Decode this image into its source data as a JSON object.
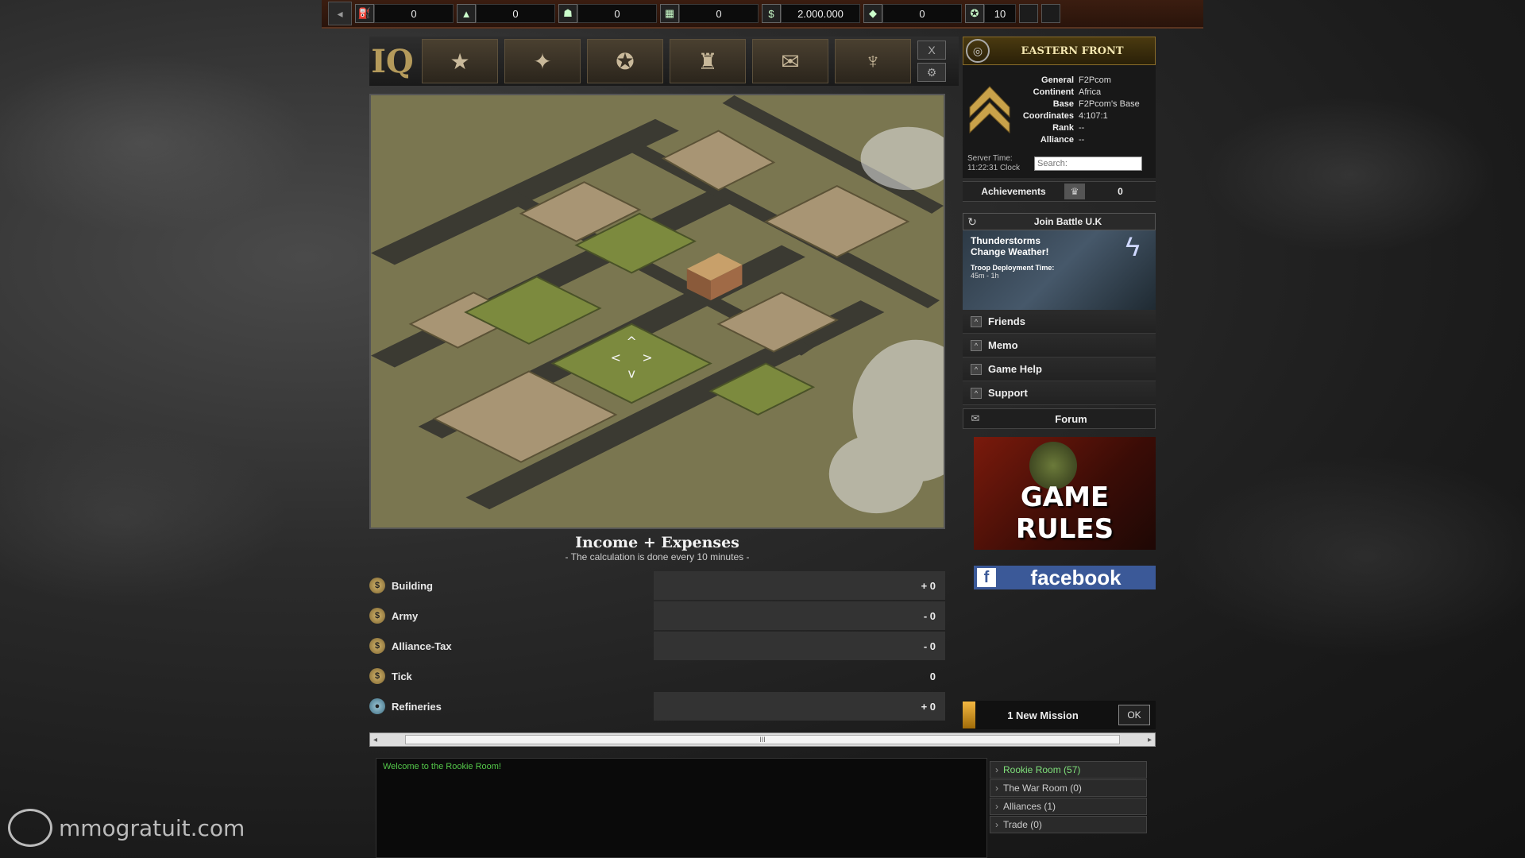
{
  "resources": [
    {
      "icon": "fuel-icon",
      "glyph": "⛽",
      "value": "0"
    },
    {
      "icon": "oil-icon",
      "glyph": "▲",
      "value": "0"
    },
    {
      "icon": "soldier-icon",
      "glyph": "☗",
      "value": "0"
    },
    {
      "icon": "building-material-icon",
      "glyph": "▦",
      "value": "0"
    },
    {
      "icon": "coin-icon",
      "glyph": "$",
      "value": "2.000.000"
    },
    {
      "icon": "gold-bar-icon",
      "glyph": "◆",
      "value": "0"
    },
    {
      "icon": "medal-icon",
      "glyph": "✪",
      "value": "10"
    }
  ],
  "nav": {
    "hq": "IQ",
    "buttons": [
      {
        "icon": "star-emblem-icon",
        "glyph": "★"
      },
      {
        "icon": "troops-icon",
        "glyph": "✦"
      },
      {
        "icon": "wings-emblem-icon",
        "glyph": "✪"
      },
      {
        "icon": "city-icon",
        "glyph": "♜"
      },
      {
        "icon": "envelope-icon",
        "glyph": "✉"
      },
      {
        "icon": "eagle-icon",
        "glyph": "♆"
      }
    ],
    "close": "X",
    "settings": "⚙"
  },
  "map": {
    "arrows": [
      "^",
      "<",
      ">",
      "v"
    ]
  },
  "income": {
    "title": "Income + Expenses",
    "subtitle": "- The calculation is done every 10 minutes -",
    "rows": [
      {
        "label": "Building",
        "value": "+ 0",
        "icon": "coin-icon",
        "glyph": "$"
      },
      {
        "label": "Army",
        "value": "- 0",
        "icon": "coin-icon",
        "glyph": "$"
      },
      {
        "label": "Alliance-Tax",
        "value": "- 0",
        "icon": "coin-icon",
        "glyph": "$"
      },
      {
        "label": "Tick",
        "value": "0",
        "icon": "coin-icon",
        "glyph": "$"
      },
      {
        "label": "Refineries",
        "value": "+ 0",
        "icon": "fuel-drop-icon",
        "glyph": "●"
      }
    ]
  },
  "scroll": {
    "left": "◂",
    "right": "▸",
    "grip": "III"
  },
  "sidebar": {
    "front_title": "EASTERN FRONT",
    "profile": {
      "General": "F2Pcom",
      "Continent": "Africa",
      "Base": "F2Pcom's Base",
      "Coordinates": "4:107:1",
      "Rank": "--",
      "Alliance": "--"
    },
    "labels": {
      "general": "General",
      "continent": "Continent",
      "base": "Base",
      "coordinates": "Coordinates",
      "rank": "Rank",
      "alliance": "Alliance"
    },
    "server_time_label": "Server Time:",
    "server_time": "11:22:31 Clock",
    "search_placeholder": "Search:",
    "achievements_label": "Achievements",
    "achievements_value": "0",
    "join_battle": "Join Battle U.K",
    "storm_line1": "Thunderstorms",
    "storm_line2": "Change Weather!",
    "deploy_label": "Troop Deployment Time:",
    "deploy_time": "45m - 1h",
    "accordion": [
      "Friends",
      "Memo",
      "Game Help",
      "Support"
    ],
    "forum": "Forum",
    "rules_banner": "GAME RULES",
    "facebook": "facebook",
    "facebook_f": "f",
    "mission": "1 New Mission",
    "ok": "OK"
  },
  "chat": {
    "message": "Welcome to the Rookie Room!",
    "rooms": [
      {
        "name": "Rookie Room (57)",
        "active": true
      },
      {
        "name": "The War Room (0)",
        "active": false
      },
      {
        "name": "Alliances (1)",
        "active": false
      },
      {
        "name": "Trade (0)",
        "active": false
      }
    ]
  },
  "watermark": "mmogratuit.com",
  "colors": {
    "accent": "#f4b842",
    "chat_text": "#54c84a",
    "facebook": "#3b5998"
  }
}
